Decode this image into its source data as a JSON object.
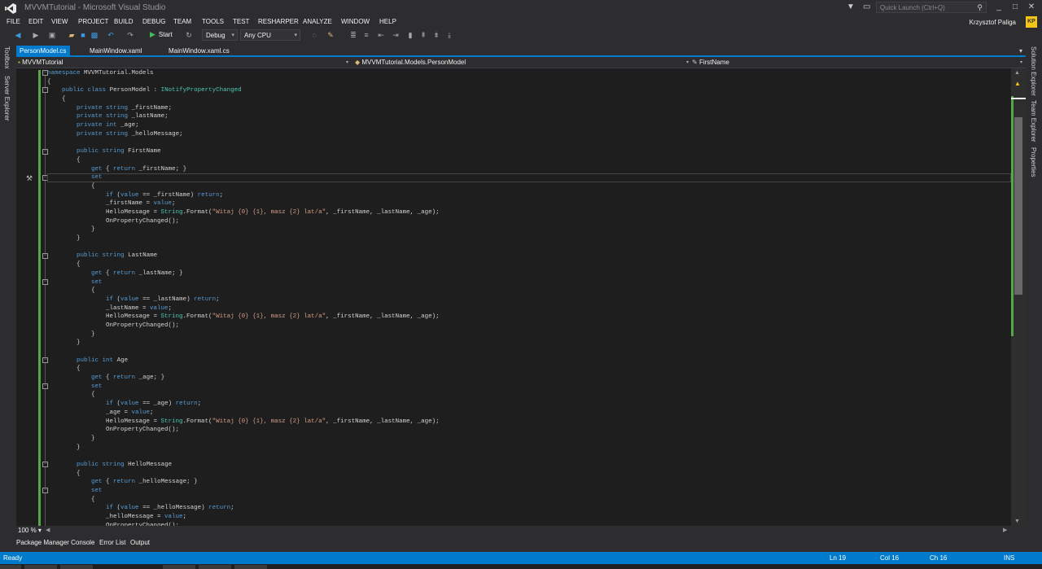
{
  "window": {
    "title": "MVVMTutorial - Microsoft Visual Studio",
    "quick_launch_placeholder": "Quick Launch (Ctrl+Q)",
    "user": "Krzysztof Paliga",
    "user_initials": "KP"
  },
  "menu": [
    "FILE",
    "EDIT",
    "VIEW",
    "PROJECT",
    "BUILD",
    "DEBUG",
    "TEAM",
    "TOOLS",
    "TEST",
    "RESHARPER",
    "ANALYZE",
    "WINDOW",
    "HELP"
  ],
  "toolbar": {
    "start_label": "Start",
    "config": "Debug",
    "platform": "Any CPU"
  },
  "left_strip": [
    "Toolbox",
    "Server Explorer"
  ],
  "right_strip": [
    "Solution Explorer",
    "Team Explorer",
    "Properties"
  ],
  "tabs": [
    {
      "label": "PersonModel.cs",
      "active": true
    },
    {
      "label": "MainWindow.xaml",
      "active": false
    },
    {
      "label": "MainWindow.xaml.cs",
      "active": false
    }
  ],
  "navbar": {
    "project": "MVVMTutorial",
    "class": "MVVMTutorial.Models.PersonModel",
    "member": "FirstName"
  },
  "zoom": "100 %",
  "bottom_tabs": [
    "Package Manager Console",
    "Error List",
    "Output"
  ],
  "status": {
    "state": "Ready",
    "ln": "Ln 19",
    "col": "Col 16",
    "ch": "Ch 16",
    "mode": "INS"
  },
  "code_lines": [
    "namespace MVVMTutorial.Models",
    "{",
    "    public class PersonModel : INotifyPropertyChanged",
    "    {",
    "        private string _firstName;",
    "        private string _lastName;",
    "        private int _age;",
    "        private string _helloMessage;",
    "",
    "        public string FirstName",
    "        {",
    "            get { return _firstName; }",
    "            set",
    "            {",
    "                if (value == _firstName) return;",
    "                _firstName = value;",
    "                HelloMessage = String.Format(\"Witaj {0} {1}, masz {2} lat/a\", _firstName, _lastName, _age);",
    "                OnPropertyChanged();",
    "            }",
    "        }",
    "",
    "        public string LastName",
    "        {",
    "            get { return _lastName; }",
    "            set",
    "            {",
    "                if (value == _lastName) return;",
    "                _lastName = value;",
    "                HelloMessage = String.Format(\"Witaj {0} {1}, masz {2} lat/a\", _firstName, _lastName, _age);",
    "                OnPropertyChanged();",
    "            }",
    "        }",
    "",
    "        public int Age",
    "        {",
    "            get { return _age; }",
    "            set",
    "            {",
    "                if (value == _age) return;",
    "                _age = value;",
    "                HelloMessage = String.Format(\"Witaj {0} {1}, masz {2} lat/a\", _firstName, _lastName, _age);",
    "                OnPropertyChanged();",
    "            }",
    "        }",
    "",
    "        public string HelloMessage",
    "        {",
    "            get { return _helloMessage; }",
    "            set",
    "            {",
    "                if (value == _helloMessage) return;",
    "                _helloMessage = value;",
    "                OnPropertyChanged();"
  ],
  "colors": {
    "keyword": "#569cd6",
    "type": "#4ec9b0",
    "string": "#d69d85",
    "accent": "#007acc"
  }
}
